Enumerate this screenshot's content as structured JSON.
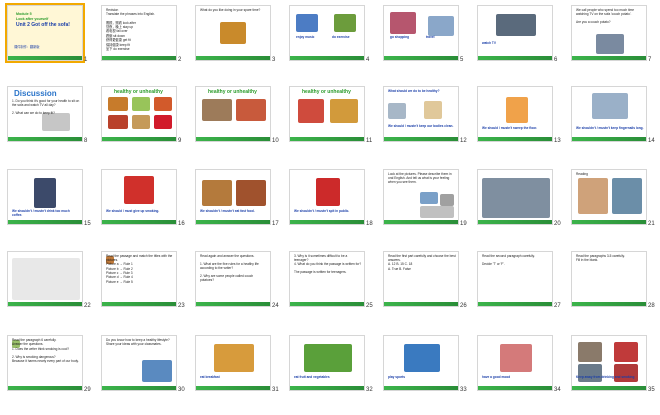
{
  "slides": [
    {
      "num": "1",
      "lines": [
        "Module 5",
        "Look after yourself",
        "Unit 2 Got off the sofa!"
      ],
      "footer": "课件制作：翻新版"
    },
    {
      "num": "2",
      "lines": [
        "Revision",
        "Translate the phrases into English.",
        "照顾，照看  look after",
        "熬夜，晚上  stay up",
        "看电视  fall over",
        "跌倒  sit down",
        "获得更健康  get fit",
        "保持健康  keep fit",
        "坐下  do exercise"
      ]
    },
    {
      "num": "3",
      "lines": [
        "What do you like doing in your spare time?"
      ]
    },
    {
      "num": "4",
      "lines": [
        "enjoy music",
        "do exercise"
      ]
    },
    {
      "num": "5",
      "lines": [
        "go shopping",
        "travel"
      ]
    },
    {
      "num": "6",
      "lines": [
        "watch TV"
      ]
    },
    {
      "num": "7",
      "lines": [
        "We call people who spend too much time watching TV on the sofa 'couch potato'.",
        "Are you a couch potato?"
      ]
    },
    {
      "num": "8",
      "lines": [
        "Discussion",
        "1. Do you think it's good for your health to sit on the sofa and watch TV all day?",
        "2. What can we do to keep fit?"
      ]
    },
    {
      "num": "9",
      "lines": [
        "healthy or unhealthy"
      ]
    },
    {
      "num": "10",
      "lines": [
        "healthy or unhealthy"
      ]
    },
    {
      "num": "11",
      "lines": [
        "healthy or unhealthy"
      ]
    },
    {
      "num": "12",
      "lines": [
        "What should we do to be healthy?",
        "We should / mustn't keep our bodies clean."
      ]
    },
    {
      "num": "13",
      "lines": [
        "We should / mustn't sweep the floor."
      ]
    },
    {
      "num": "14",
      "lines": [
        "We shouldn't / mustn't keep fingernails long."
      ]
    },
    {
      "num": "15",
      "lines": [
        "We shouldn't / mustn't drink too much coffee."
      ]
    },
    {
      "num": "16",
      "lines": [
        "We should / must give up smoking."
      ]
    },
    {
      "num": "17",
      "lines": [
        "We shouldn't / mustn't eat fast food."
      ]
    },
    {
      "num": "18",
      "lines": [
        "We shouldn't / mustn't spit in public."
      ]
    },
    {
      "num": "19",
      "lines": [
        "Look at the pictures. Please describe them in oral English. And tell us what is your feeling when you see them."
      ]
    },
    {
      "num": "20",
      "lines": []
    },
    {
      "num": "21",
      "lines": [
        "Reading"
      ]
    },
    {
      "num": "22",
      "lines": []
    },
    {
      "num": "23",
      "lines": [
        "Read the passage and match the titles with the pictures.",
        "Picture a → Rule 1",
        "Picture b → Rule 2",
        "Picture c → Rule 3",
        "Picture d → Rule 4",
        "Picture e → Rule 5"
      ]
    },
    {
      "num": "24",
      "lines": [
        "Read again and answer the questions.",
        "1. What are the five rules for a healthy life according to the writer?",
        "2. Why are some people called couch potatoes?"
      ]
    },
    {
      "num": "25",
      "lines": [
        "3. Why is it sometimes difficult to be a teenager?",
        "4. What do you think the passage is written for?",
        "The passage is written for teenagers."
      ]
    },
    {
      "num": "26",
      "lines": [
        "Read the first part carefully and choose the best answers.",
        "A. 12  B. 15  C. 18",
        "A. True  B. False"
      ]
    },
    {
      "num": "27",
      "lines": [
        "Read the second paragraph carefully.",
        "Decide 'T' or 'F'."
      ]
    },
    {
      "num": "28",
      "lines": [
        "Read the paragraphs 3-5 carefully.",
        "Fill in the blank."
      ]
    },
    {
      "num": "29",
      "lines": [
        "Read the paragraph 6 carefully.",
        "Answer the questions.",
        "1. Does the writer think smoking is cool?",
        "2. Why is smoking dangerous?",
        "Because it harms nearly every part of our body."
      ]
    },
    {
      "num": "30",
      "lines": [
        "Do you know how to keep a healthy lifestyle? Share your ideas with your classmates."
      ]
    },
    {
      "num": "31",
      "lines": [
        "eat breakfast"
      ]
    },
    {
      "num": "32",
      "lines": [
        "eat fruit and vegetables"
      ]
    },
    {
      "num": "33",
      "lines": [
        "play sports"
      ]
    },
    {
      "num": "34",
      "lines": [
        "have a good mood"
      ]
    },
    {
      "num": "35",
      "lines": [
        "Keep away from drinking and smoking"
      ]
    }
  ],
  "colors": {
    "selected": "#f2a900",
    "green": "#2fa34a",
    "blue_text": "#1a3ea8"
  }
}
